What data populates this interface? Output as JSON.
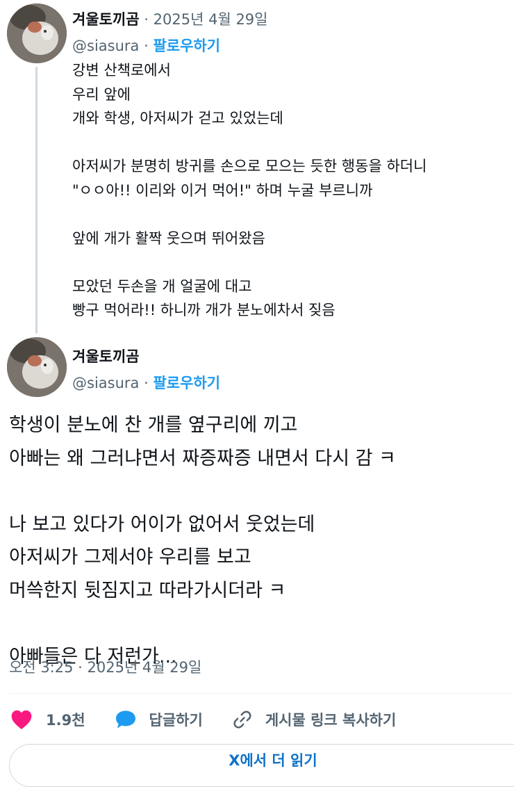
{
  "reply_tweet": {
    "author_name": "겨울토끼곰",
    "date": "· 2025년 4월 29일",
    "handle": "@siasura",
    "separator": " · ",
    "follow_label": "팔로우하기",
    "text": "강변 산책로에서\n우리 앞에\n개와 학생, 아저씨가 걷고 있었는데\n\n아저씨가 분명히 방귀를 손으로 모으는 듯한 행동을 하더니\n\"ㅇㅇ아!! 이리와 이거 먹어!\" 하며 누굴 부르니까\n\n앞에 개가 활짝 웃으며 뛰어왔음\n\n모았던 두손을 개 얼굴에 대고\n빵구 먹어라!! 하니까 개가 분노에차서 짖음"
  },
  "main_tweet": {
    "author_name": "겨울토끼곰",
    "handle": "@siasura",
    "separator": " · ",
    "follow_label": "팔로우하기",
    "text": "학생이 분노에 찬 개를 옆구리에 끼고\n아빠는 왜 그러냐면서 짜증짜증 내면서 다시 감 ㅋ\n\n나 보고 있다가 어이가 없어서 웃었는데\n아저씨가 그제서야 우리를 보고\n머쓱한지 뒷짐지고 따라가시더라 ㅋ\n\n아빠들은 다 저런가...",
    "timestamp": "오전 3:25 · 2025년 4월 29일"
  },
  "actions": {
    "like_count": "1.9천",
    "reply_label": "답글하기",
    "copy_link_label": "게시물 링크 복사하기"
  },
  "read_more_label": "X에서 더 읽기",
  "colors": {
    "accent": "#1d9bf0",
    "like": "#f91880",
    "secondary_text": "#536471"
  },
  "icons": [
    "heart-icon",
    "speech-bubble-icon",
    "link-icon"
  ]
}
